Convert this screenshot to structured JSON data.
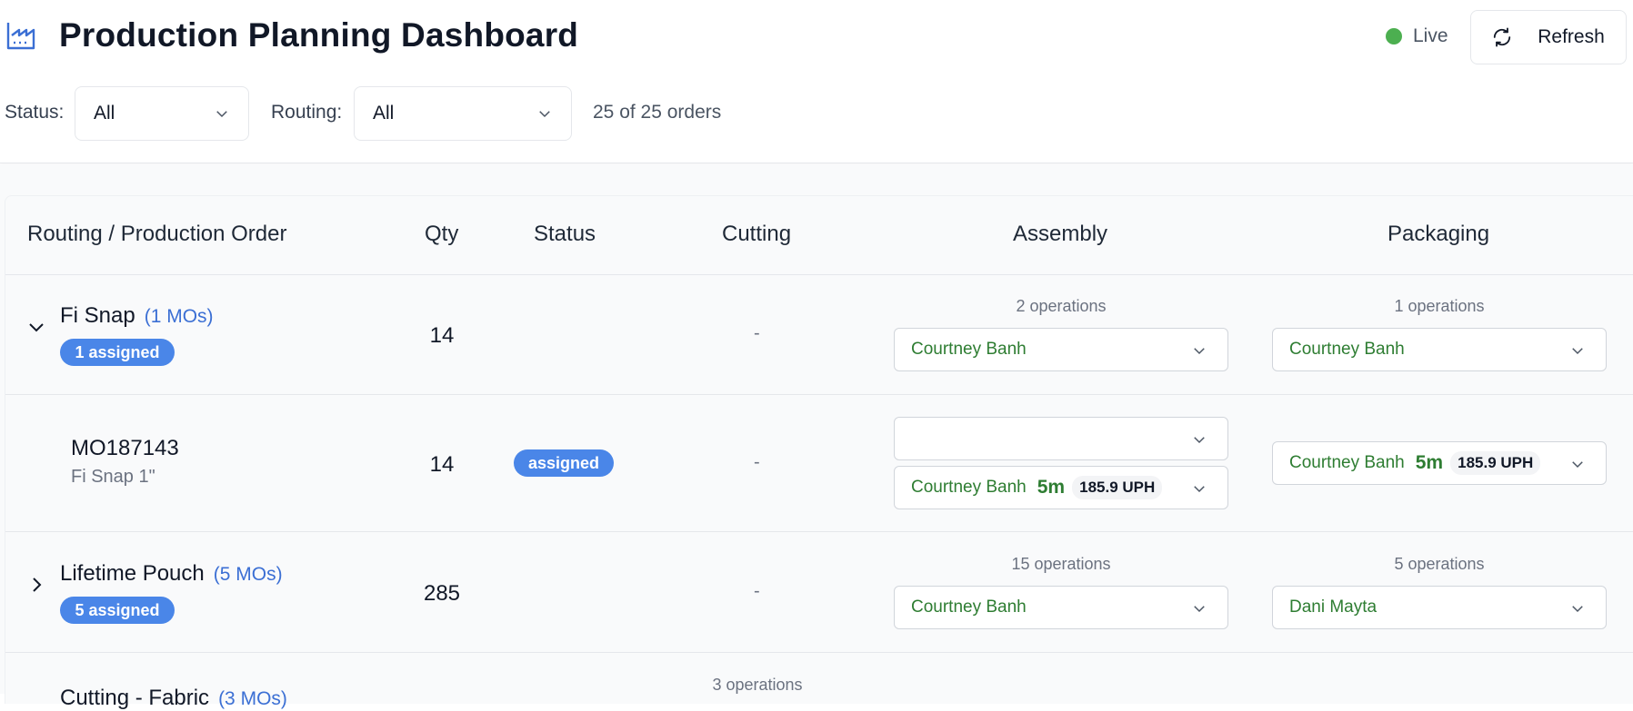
{
  "header": {
    "title": "Production Planning Dashboard",
    "live_label": "Live",
    "refresh_label": "Refresh"
  },
  "filters": {
    "status_label": "Status:",
    "status_value": "All",
    "routing_label": "Routing:",
    "routing_value": "All",
    "count_text": "25 of 25 orders"
  },
  "table": {
    "columns": [
      "Routing / Production Order",
      "Qty",
      "Status",
      "Cutting",
      "Assembly",
      "Packaging"
    ],
    "rows": [
      {
        "type": "group",
        "name": "Fi Snap",
        "mo_count": "(1 MOs)",
        "badge": "1 assigned",
        "qty": "14",
        "cutting": "-",
        "assembly_ops": "2 operations",
        "assembly_assignee": "Courtney Banh",
        "packaging_ops": "1 operations",
        "packaging_assignee": "Courtney Banh"
      },
      {
        "type": "order",
        "id": "MO187143",
        "product": "Fi Snap 1\"",
        "qty": "14",
        "status": "assigned",
        "cutting": "-",
        "assembly_assignee": "Courtney Banh",
        "assembly_minutes": "5m",
        "assembly_uph": "185.9 UPH",
        "packaging_assignee": "Courtney Banh",
        "packaging_minutes": "5m",
        "packaging_uph": "185.9 UPH"
      },
      {
        "type": "group",
        "name": "Lifetime Pouch",
        "mo_count": "(5 MOs)",
        "badge": "5 assigned",
        "qty": "285",
        "cutting": "-",
        "assembly_ops": "15 operations",
        "assembly_assignee": "Courtney Banh",
        "packaging_ops": "5 operations",
        "packaging_assignee": "Dani Mayta"
      },
      {
        "type": "group",
        "name": "Cutting - Fabric",
        "mo_count": "(3 MOs)",
        "cutting_ops": "3 operations"
      }
    ]
  },
  "colors": {
    "accent": "#4a86e8",
    "live": "#4caf50",
    "assignee_text": "#2e7d32"
  }
}
